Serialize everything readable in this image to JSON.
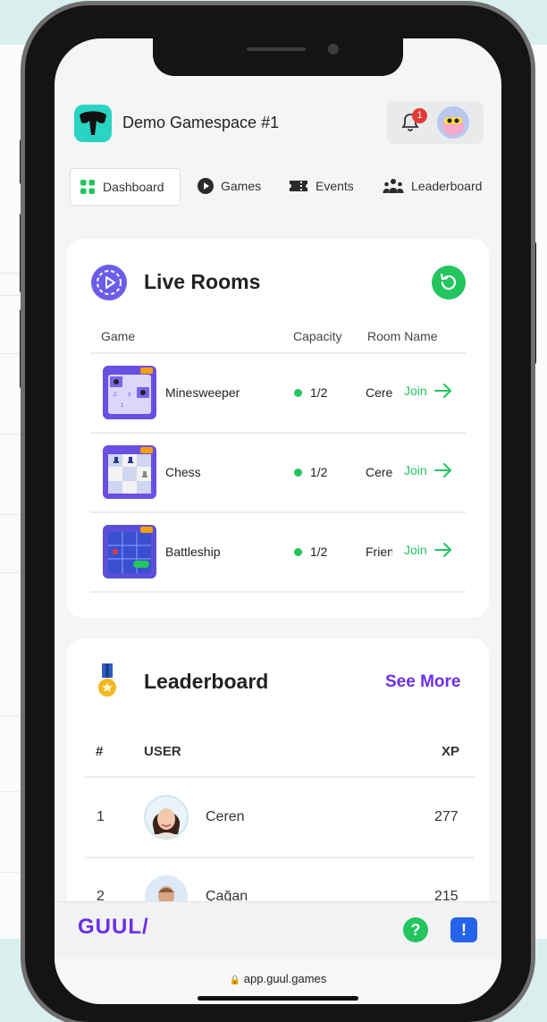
{
  "header": {
    "title": "Demo Gamespace #1",
    "notification_count": "1"
  },
  "tabs": [
    {
      "label": "Dashboard",
      "icon": "grid-icon"
    },
    {
      "label": "Games",
      "icon": "play-icon"
    },
    {
      "label": "Events",
      "icon": "ticket-icon"
    },
    {
      "label": "Leaderboard",
      "icon": "users-icon"
    }
  ],
  "live_rooms": {
    "title": "Live Rooms",
    "columns": {
      "game": "Game",
      "capacity": "Capacity",
      "room": "Room Name"
    },
    "rows": [
      {
        "game": "Minesweeper",
        "capacity": "1/2",
        "room": "Cere",
        "action": "Join"
      },
      {
        "game": "Chess",
        "capacity": "1/2",
        "room": "Cere",
        "action": "Join"
      },
      {
        "game": "Battleship",
        "capacity": "1/2",
        "room": "Frien",
        "action": "Join"
      }
    ]
  },
  "leaderboard": {
    "title": "Leaderboard",
    "see_more": "See More",
    "columns": {
      "rank": "#",
      "user": "USER",
      "xp": "XP"
    },
    "rows": [
      {
        "rank": "1",
        "user": "Ceren",
        "xp": "277"
      },
      {
        "rank": "2",
        "user": "Çağan",
        "xp": "215"
      }
    ]
  },
  "footer": {
    "brand": "GUUL/",
    "help": "?",
    "feedback": "!"
  },
  "browser": {
    "url": "app.guul.games"
  },
  "colors": {
    "accent_green": "#22c55e",
    "brand_purple": "#6d2ee8",
    "logo_teal": "#2ad4c3"
  }
}
